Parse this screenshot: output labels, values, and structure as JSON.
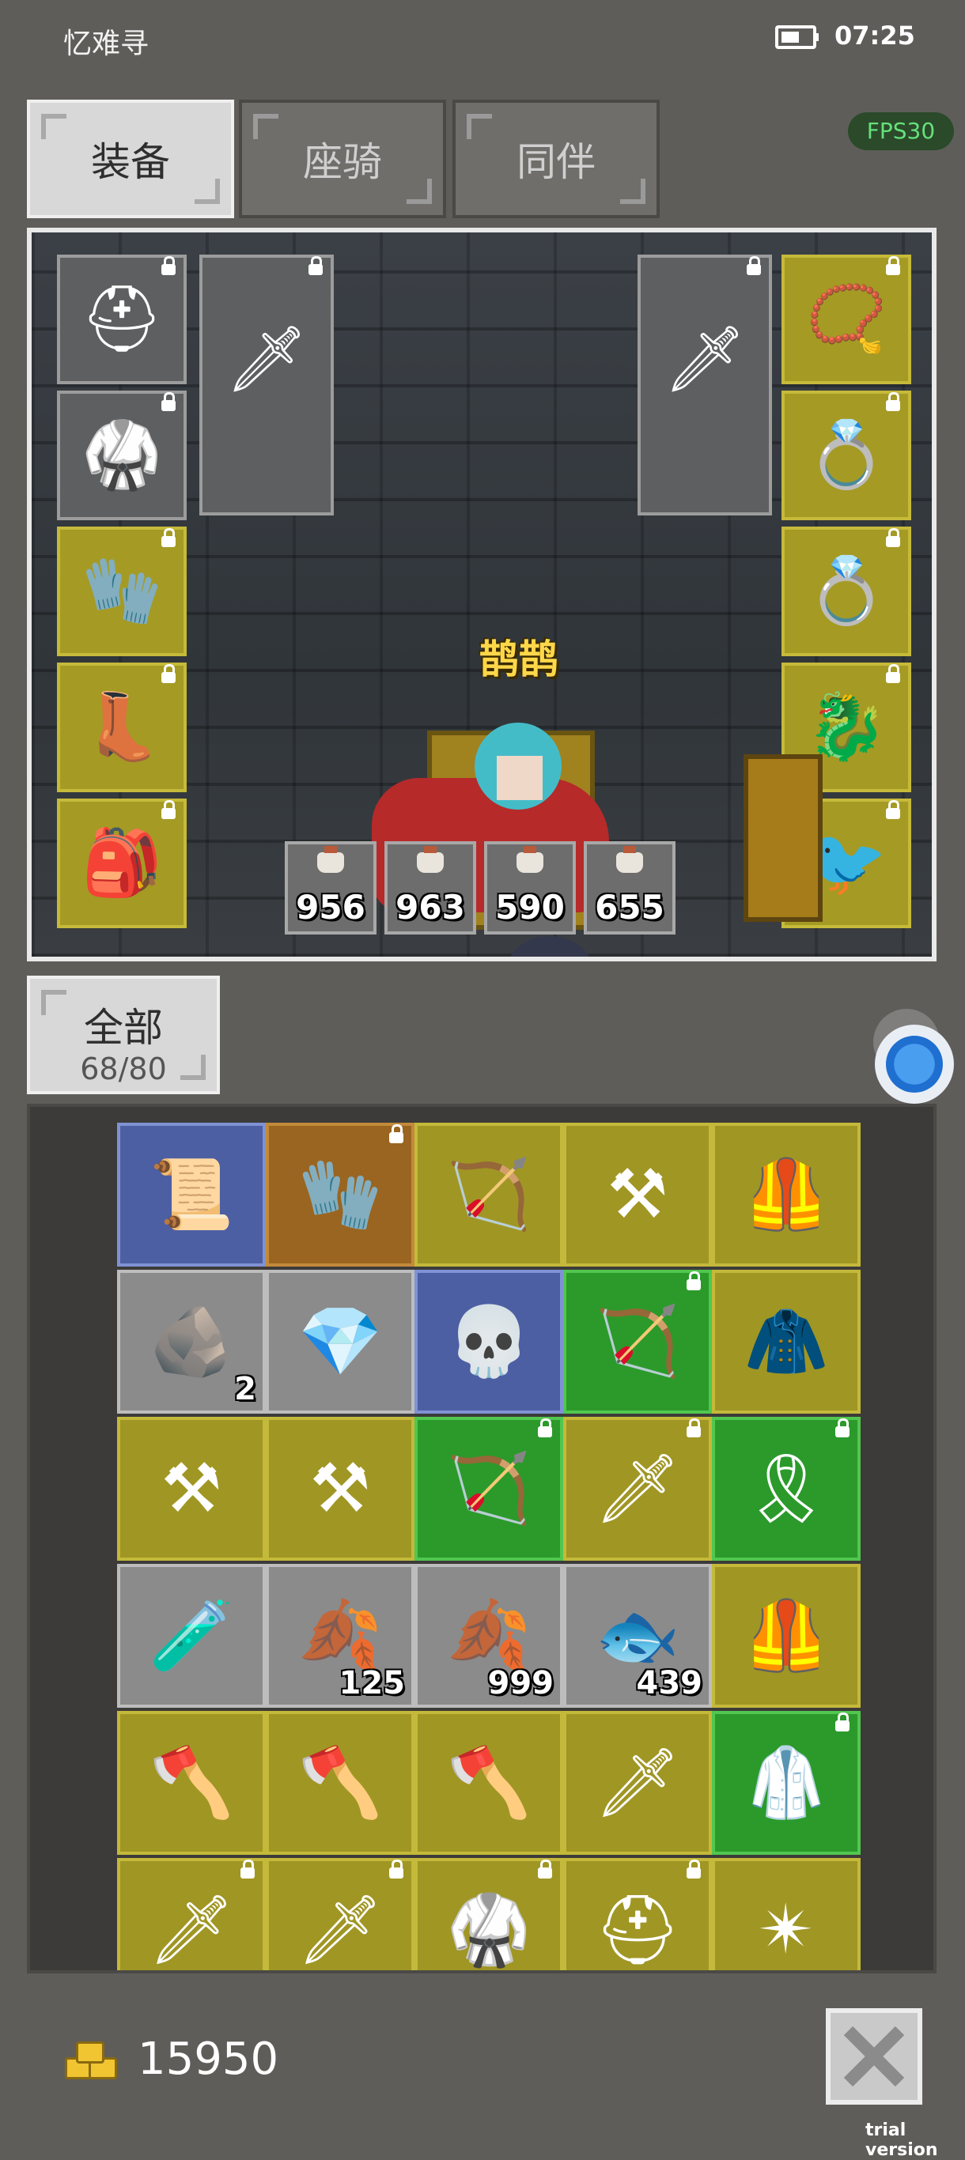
{
  "status_bar": {
    "app_name": "忆难寻",
    "time": "07:25"
  },
  "fps": "FPS30",
  "tabs": [
    {
      "label": "装备",
      "active": true
    },
    {
      "label": "座骑",
      "active": false
    },
    {
      "label": "同伴",
      "active": false
    }
  ],
  "equipment": {
    "left_slots": [
      "helmet-icon",
      "armor-icon",
      "gauntlet-icon",
      "boots-icon",
      "belt-icon"
    ],
    "weapon_slots": [
      "sword-icon",
      "sword-icon"
    ],
    "right_slots": [
      "amulet-icon",
      "ring-icon",
      "ring-icon",
      "dragon-mount-icon",
      "magpie-pet-icon"
    ],
    "pet_name": "鹊鹊",
    "potions": [
      "956",
      "963",
      "590",
      "655"
    ]
  },
  "filter": {
    "label": "全部",
    "count": "68/80"
  },
  "inventory": [
    {
      "icon": "scroll-icon",
      "color": "blue",
      "qty": ""
    },
    {
      "icon": "glove-icon",
      "color": "orange",
      "qty": ""
    },
    {
      "icon": "crossbow-icon",
      "color": "yellow",
      "qty": ""
    },
    {
      "icon": "scythe-icon",
      "color": "yellow",
      "qty": ""
    },
    {
      "icon": "chestplate-icon",
      "color": "yellow",
      "qty": ""
    },
    {
      "icon": "rune-stone-icon",
      "color": "grey",
      "qty": "2"
    },
    {
      "icon": "emerald-icon",
      "color": "grey",
      "qty": ""
    },
    {
      "icon": "skull-banner-icon",
      "color": "blue",
      "qty": ""
    },
    {
      "icon": "bow-icon",
      "color": "green",
      "qty": ""
    },
    {
      "icon": "robe-icon",
      "color": "yellow",
      "qty": ""
    },
    {
      "icon": "scythe-icon",
      "color": "yellow",
      "qty": ""
    },
    {
      "icon": "scythe-icon",
      "color": "yellow",
      "qty": ""
    },
    {
      "icon": "bow-icon",
      "color": "green",
      "qty": ""
    },
    {
      "icon": "sword-icon",
      "color": "yellow",
      "qty": ""
    },
    {
      "icon": "belt-icon",
      "color": "green",
      "qty": ""
    },
    {
      "icon": "potion-icon",
      "color": "grey",
      "qty": ""
    },
    {
      "icon": "red-leaf-icon",
      "color": "grey",
      "qty": "125"
    },
    {
      "icon": "red-leaf-icon",
      "color": "grey",
      "qty": "999"
    },
    {
      "icon": "fish-icon",
      "color": "grey",
      "qty": "439"
    },
    {
      "icon": "chestplate-icon",
      "color": "yellow",
      "qty": ""
    },
    {
      "icon": "battle-axe-icon",
      "color": "yellow",
      "qty": ""
    },
    {
      "icon": "battle-axe-icon",
      "color": "yellow",
      "qty": ""
    },
    {
      "icon": "battle-axe-icon",
      "color": "yellow",
      "qty": ""
    },
    {
      "icon": "sword-icon",
      "color": "yellow",
      "qty": ""
    },
    {
      "icon": "dark-armor-icon",
      "color": "green",
      "qty": ""
    },
    {
      "icon": "sword-icon",
      "color": "yellow",
      "qty": ""
    },
    {
      "icon": "sword-icon",
      "color": "yellow",
      "qty": ""
    },
    {
      "icon": "armor-icon",
      "color": "yellow",
      "qty": ""
    },
    {
      "icon": "helmet-icon",
      "color": "yellow",
      "qty": ""
    },
    {
      "icon": "mace-icon",
      "color": "yellow",
      "qty": ""
    }
  ],
  "gold": "15950",
  "watermark": "trial version"
}
